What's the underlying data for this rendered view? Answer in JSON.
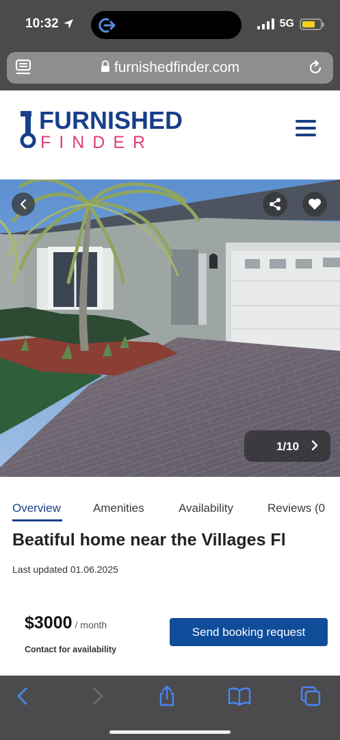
{
  "status_bar": {
    "time": "10:32",
    "network": "5G"
  },
  "browser": {
    "url": "furnishedfinder.com"
  },
  "header": {
    "logo_top": "FURNISHED",
    "logo_bottom": "FINDER"
  },
  "gallery": {
    "counter": "1/10"
  },
  "tabs": [
    {
      "label": "Overview",
      "active": true
    },
    {
      "label": "Amenities"
    },
    {
      "label": "Availability"
    },
    {
      "label": "Reviews (0"
    }
  ],
  "listing": {
    "title": "Beatiful home near the Villages Fl",
    "last_updated": "Last updated 01.06.2025",
    "price": "$3000",
    "price_unit": "/ month",
    "contact": "Contact for availability",
    "cta": "Send booking request"
  },
  "colors": {
    "brand_blue": "#173f8a",
    "brand_pink": "#e03c77",
    "button_blue": "#0f4c9a",
    "chrome": "#4b4b4d"
  },
  "icons": [
    "location-arrow-icon",
    "island-activity-icon",
    "signal-icon",
    "battery-icon",
    "reader-icon",
    "lock-icon",
    "reload-icon",
    "key-logo-icon",
    "hamburger-icon",
    "chevron-left-icon",
    "share-icon",
    "heart-icon",
    "chevron-right-icon",
    "back-icon",
    "forward-icon",
    "share-sheet-icon",
    "bookmarks-icon",
    "tabs-icon"
  ]
}
